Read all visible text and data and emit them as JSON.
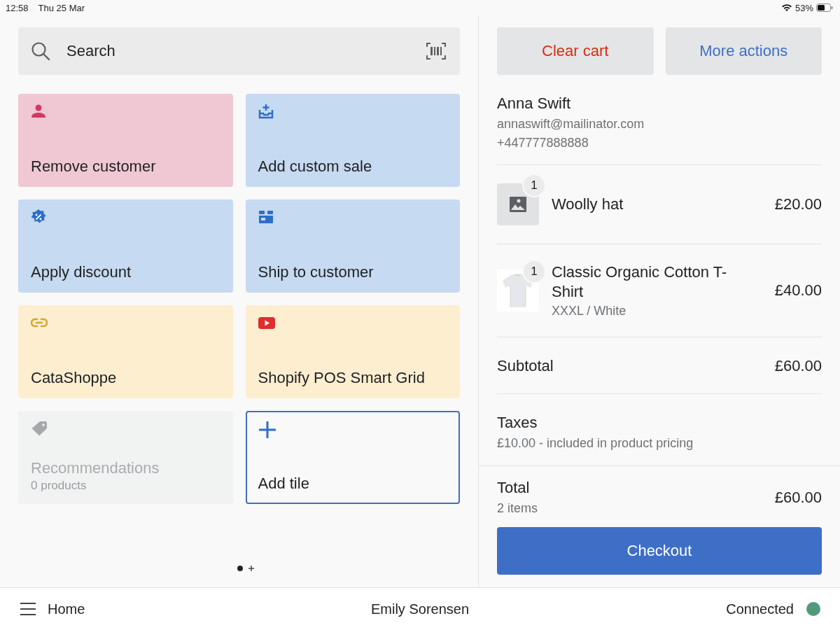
{
  "status_bar": {
    "time": "12:58",
    "date": "Thu 25 Mar",
    "battery": "53%"
  },
  "search": {
    "placeholder": "Search"
  },
  "tiles": [
    {
      "kind": "customer",
      "label": "Remove customer",
      "color": "#efc8d3",
      "disabled": false
    },
    {
      "kind": "custom-sale",
      "label": "Add custom sale",
      "color": "#c6daf1",
      "disabled": false
    },
    {
      "kind": "discount",
      "label": "Apply discount",
      "color": "#c6daf1",
      "disabled": false
    },
    {
      "kind": "shipping",
      "label": "Ship to customer",
      "color": "#c6daf1",
      "disabled": false
    },
    {
      "kind": "link",
      "label": "CataShoppe",
      "color": "#fdeed0",
      "disabled": false
    },
    {
      "kind": "video",
      "label": "Shopify POS Smart Grid",
      "color": "#fdeed0",
      "disabled": false
    },
    {
      "kind": "recommendations",
      "label": "Recommendations",
      "subtitle": "0 products",
      "color": "#f1f2f2",
      "disabled": true
    },
    {
      "kind": "add",
      "label": "Add tile",
      "color": "#f9f9f9",
      "disabled": false
    }
  ],
  "page_dots": [
    {
      "selected": true
    }
  ],
  "cart": {
    "actions": [
      {
        "kind": "destructive",
        "label": "Clear cart"
      },
      {
        "kind": "primary",
        "label": "More actions"
      }
    ],
    "customer": {
      "name": "Anna Swift",
      "email": "annaswift@mailinator.com",
      "phone": "+447777888888"
    },
    "line_items": [
      {
        "kind": "placeholder",
        "quantity": "1",
        "name": "Woolly hat",
        "price": "£20.00"
      },
      {
        "kind": "picture",
        "quantity": "1",
        "name": "Classic Organic Cotton T-Shirt",
        "variant": "XXXL / White",
        "price": "£40.00"
      }
    ],
    "subtotal": {
      "label": "Subtotal",
      "value": "£60.00"
    },
    "taxes": {
      "label": "Taxes",
      "note": "£10.00 - included in product pricing"
    },
    "total": {
      "label": "Total",
      "count": "2 items",
      "value": "£60.00"
    },
    "checkout": "Checkout"
  },
  "bottom_bar": {
    "menu_label": "Home",
    "user": "Emily Sorensen",
    "connection": "Connected",
    "connected": true
  }
}
